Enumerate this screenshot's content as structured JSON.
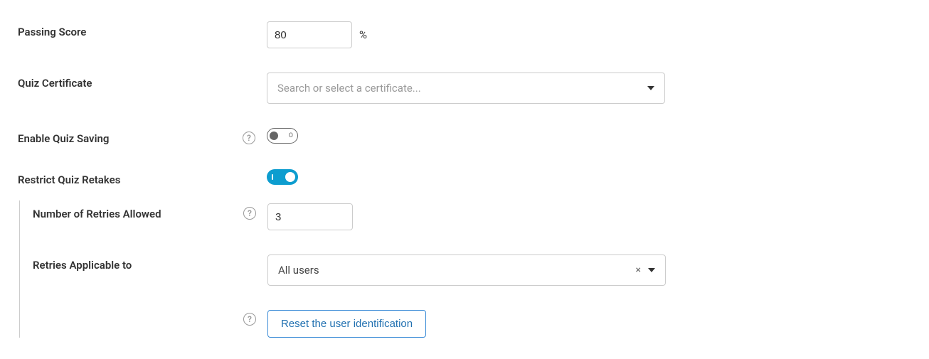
{
  "passingScore": {
    "label": "Passing Score",
    "value": "80",
    "suffix": "%"
  },
  "quizCertificate": {
    "label": "Quiz Certificate",
    "placeholder": "Search or select a certificate..."
  },
  "enableQuizSaving": {
    "label": "Enable Quiz Saving",
    "value": false,
    "offMark": "O"
  },
  "restrictQuizRetakes": {
    "label": "Restrict Quiz Retakes",
    "value": true
  },
  "numberOfRetries": {
    "label": "Number of Retries Allowed",
    "value": "3"
  },
  "retriesApplicableTo": {
    "label": "Retries Applicable to",
    "value": "All users"
  },
  "resetButton": {
    "label": "Reset the user identification"
  }
}
